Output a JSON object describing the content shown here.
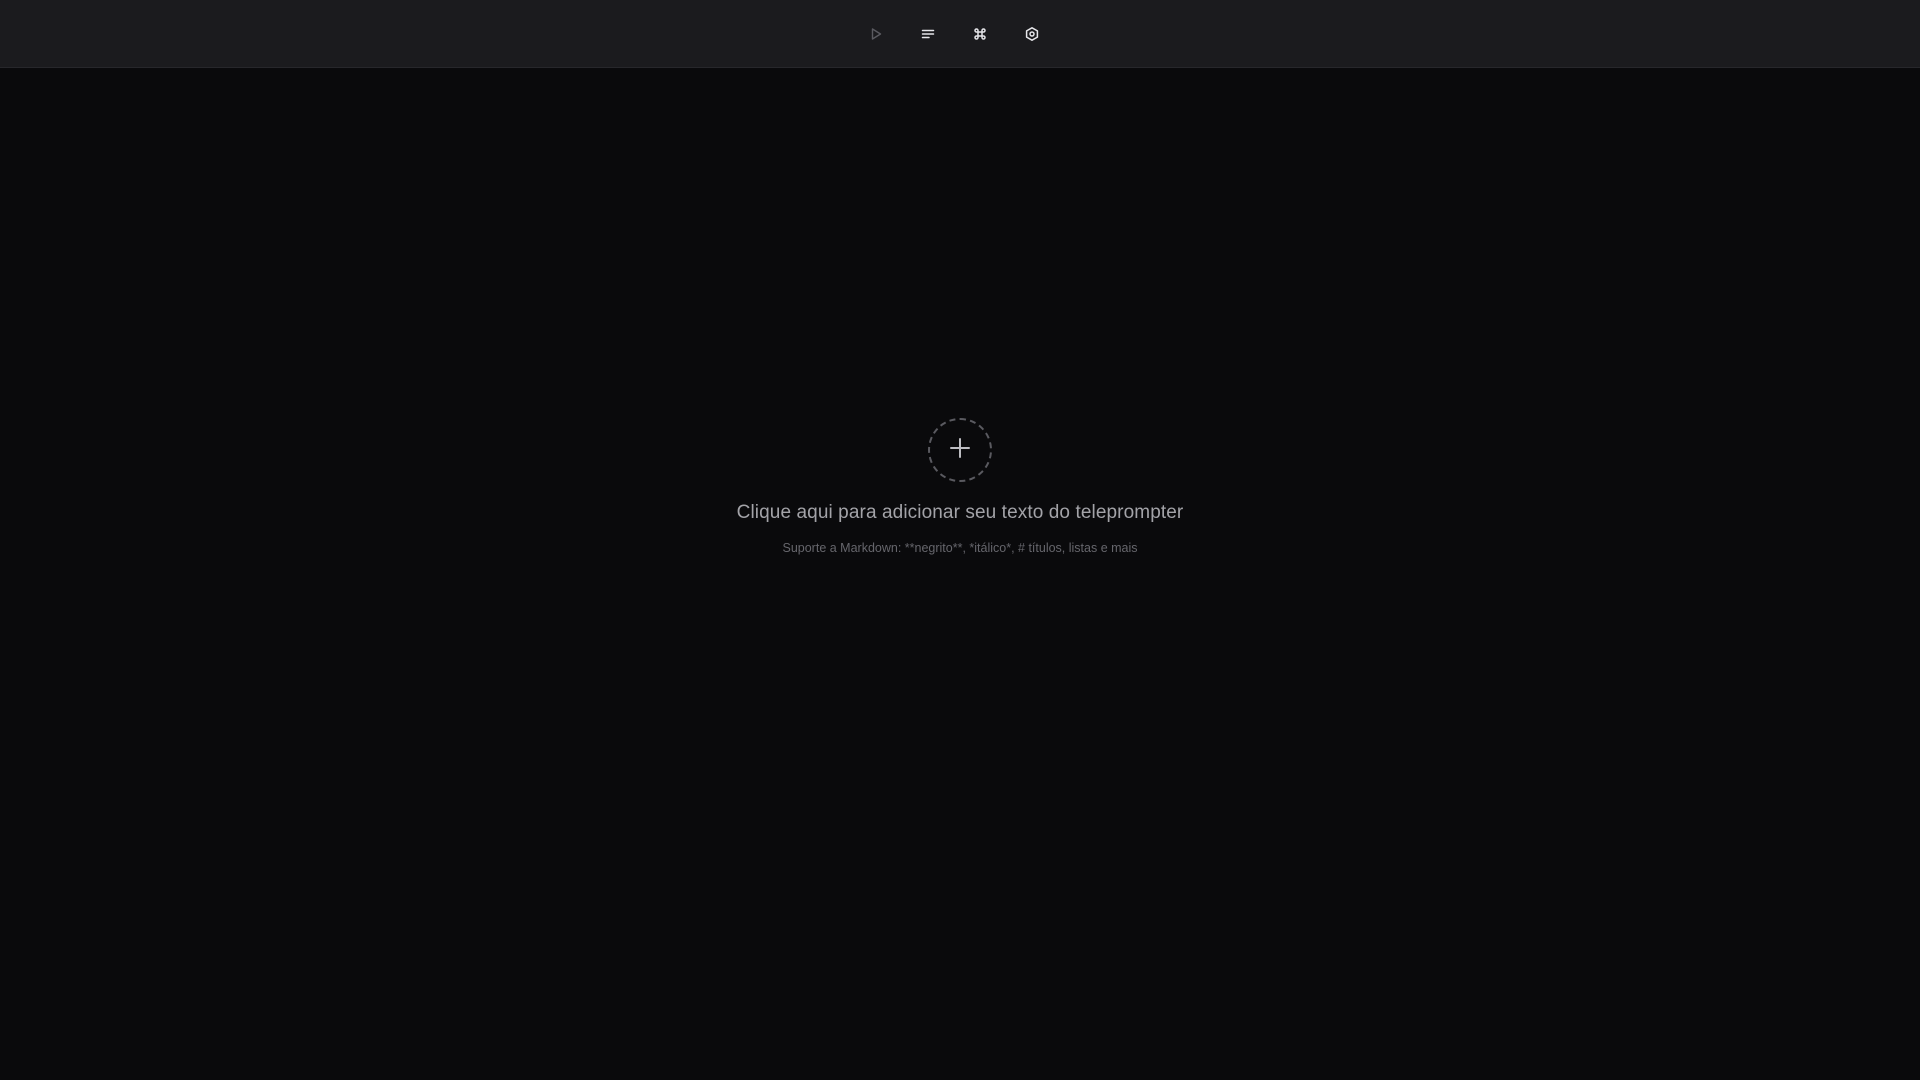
{
  "toolbar": {
    "buttons": [
      {
        "icon": "play-icon",
        "state": "disabled",
        "color": "#5a5a60"
      },
      {
        "icon": "align-left-icon",
        "color": "#e6e6ea"
      },
      {
        "icon": "command-icon",
        "color": "#e6e6ea"
      },
      {
        "icon": "settings-icon",
        "color": "#e6e6ea"
      }
    ]
  },
  "empty_state": {
    "icon": "plus-icon",
    "title": "Clique aqui para adicionar seu texto do teleprompter",
    "subtitle": "Suporte a Markdown: **negrito**, *itálico*, # títulos, listas e mais"
  },
  "colors": {
    "background": "#0a0a0c",
    "toolbar_background": "#1b1b1e",
    "title_text": "#a3a3a8",
    "subtitle_text": "#66666c"
  }
}
